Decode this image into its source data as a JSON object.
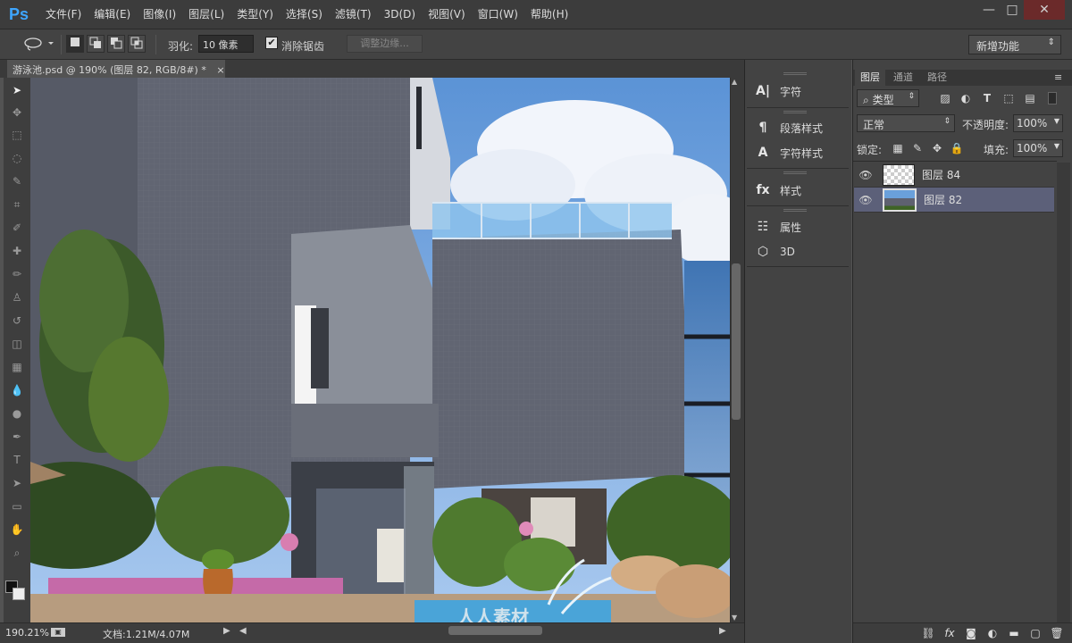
{
  "app": {
    "logo": "Ps"
  },
  "menu": [
    "文件(F)",
    "编辑(E)",
    "图像(I)",
    "图层(L)",
    "类型(Y)",
    "选择(S)",
    "滤镜(T)",
    "3D(D)",
    "视图(V)",
    "窗口(W)",
    "帮助(H)"
  ],
  "window_controls": {
    "minimize": "—",
    "maximize": "□",
    "close": "✕"
  },
  "options": {
    "feather_label": "羽化:",
    "feather_value": "10 像素",
    "anti_alias_label": "消除锯齿",
    "anti_alias_checked": true,
    "refine_edge_label": "调整边缘...",
    "workspace_label": "新增功能"
  },
  "document": {
    "tab_title": "游泳池.psd @ 190% (图层 82, RGB/8#) *",
    "close_glyph": "×"
  },
  "status": {
    "zoom": "190.21%",
    "doc_info": "文档:1.21M/4.07M"
  },
  "mid_panel": {
    "items": [
      {
        "label": "字符",
        "icon": "character-icon"
      },
      {
        "label": "段落样式",
        "icon": "paragraph-style-icon"
      },
      {
        "label": "字符样式",
        "icon": "character-style-icon"
      },
      {
        "label": "样式",
        "icon": "styles-icon"
      },
      {
        "label": "属性",
        "icon": "properties-icon"
      },
      {
        "label": "3D",
        "icon": "3d-icon"
      }
    ]
  },
  "layers_panel": {
    "tabs": [
      "图层",
      "通道",
      "路径"
    ],
    "active_tab": "图层",
    "filter_type": "类型",
    "blend_mode": "正常",
    "opacity_label": "不透明度:",
    "opacity_value": "100%",
    "lock_label": "锁定:",
    "fill_label": "填充:",
    "fill_value": "100%",
    "layers": [
      {
        "name": "图层 84",
        "visible": true,
        "selected": false
      },
      {
        "name": "图层 82",
        "visible": true,
        "selected": true
      }
    ]
  },
  "watermark": "人人素材",
  "colors": {
    "accent": "#3ea6ff",
    "selected_layer": "#5c6079",
    "panel_bg": "#434343"
  }
}
